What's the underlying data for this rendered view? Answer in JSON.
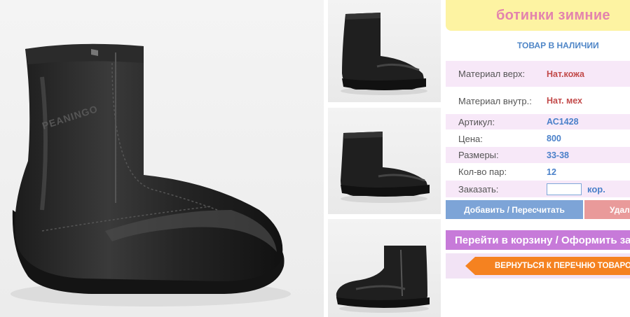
{
  "product": {
    "title": "ботинки зимние",
    "stock_status": "ТОВАР В НАЛИЧИИ"
  },
  "specs": [
    {
      "label": "Материал верх:",
      "value": "Нат.кожа"
    },
    {
      "label": "Материал внутр.:",
      "value": "Нат. мех"
    },
    {
      "label": "Артикул:",
      "value": "АС1428"
    },
    {
      "label": "Цена:",
      "value": "800"
    },
    {
      "label": "Размеры:",
      "value": "33-38"
    },
    {
      "label": "Кол-во пар:",
      "value": "12"
    }
  ],
  "order": {
    "label": "Заказать:",
    "value": "",
    "unit": "кор."
  },
  "buttons": {
    "add": "Добавить / Пересчитать",
    "delete": "Удалить",
    "cart": "Перейти в корзину / Оформить заказ",
    "back": "ВЕРНУТЬСЯ К ПЕРЕЧНЮ ТОВАРОВ"
  },
  "images": {
    "main_alt": "boot-main-photo",
    "thumbnails": [
      "boot-thumb-1",
      "boot-thumb-2",
      "boot-thumb-3"
    ]
  },
  "colors": {
    "title_bg": "#fdf3a2",
    "title_text": "#e383ae",
    "row_pink": "#f7e8f8",
    "value_red": "#c24a4a",
    "value_blue": "#4a80c9",
    "btn_add": "#7da4d7",
    "btn_delete": "#e99a9a",
    "btn_cart": "#c77ad9",
    "btn_back": "#f58220"
  }
}
